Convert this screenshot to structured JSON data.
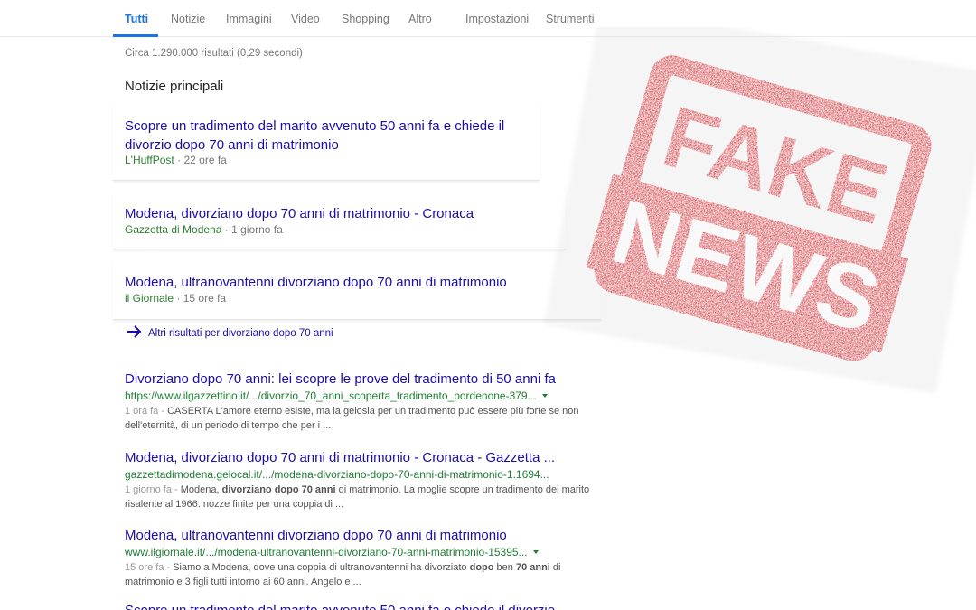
{
  "nav": {
    "tabs": [
      "Tutti",
      "Notizie",
      "Immagini",
      "Video",
      "Shopping",
      "Altro",
      "Impostazioni",
      "Strumenti"
    ],
    "active": "Tutti",
    "accent": "#1a73e8"
  },
  "stats": "Circa 1.290.000 risultati (0,29 secondi)",
  "top_stories": {
    "title": "Notizie principali",
    "cards": [
      {
        "title": "Scopre un tradimento del marito avvenuto 50 anni fa e chiede il divorzio dopo 70 anni di matrimonio",
        "source": "L'HuffPost",
        "time": "22 ore fa"
      },
      {
        "title": "Modena, divorziano dopo 70 anni di matrimonio - Cronaca",
        "source": "Gazzetta di Modena",
        "time": "1 giorno fa"
      },
      {
        "title": "Modena, ultranovantenni divorziano dopo 70 anni di matrimonio",
        "source": "il Giornale",
        "time": "15 ore fa"
      }
    ],
    "more_label": "Altri risultati per divorziano dopo 70 anni"
  },
  "results": [
    {
      "title": "Divorziano dopo 70 anni: lei scopre le prove del tradimento di 50 anni fa",
      "url": "https://www.ilgazzettino.it/.../divorzio_70_anni_scoperta_tradimento_pordenone-379...",
      "date": "1 ora fa",
      "snippet": "CASERTA L'amore eterno esiste, ma la gelosia per un tradimento può essere più forte se non dell'eternità, di un periodo di tempo che per i ..."
    },
    {
      "title": "Modena, divorziano dopo 70 anni di matrimonio - Cronaca - Gazzetta ...",
      "url": "gazzettadimodena.gelocal.it/.../modena-divorziano-dopo-70-anni-di-matrimonio-1.1694...",
      "date": "1 giorno fa",
      "snippet_parts": [
        "Modena, ",
        "divorziano dopo 70 anni",
        " di matrimonio. La moglie scopre un tradimento del marito risalente al 1966: nozze finite per una coppia di ..."
      ]
    },
    {
      "title": "Modena, ultranovantenni divorziano dopo 70 anni di matrimonio",
      "url": "www.ilgiornale.it/.../modena-ultranovantenni-divorziano-70-anni-matrimonio-15395...",
      "date": "15 ore fa",
      "snippet_parts": [
        "Siamo a Modena, dove una coppia di ultranovantenni ha divorziato ",
        "dopo",
        " ben ",
        "70 anni",
        " di matrimonio e 3 figli tutti intorno ai 60 anni. Angelo e ..."
      ]
    },
    {
      "title": "Scopre un tradimento del marito avvenuto 50 anni fa e chiede il divorzio"
    }
  ],
  "stamp": {
    "line1": "FAKE",
    "line2": "NEWS",
    "color": "#d7232a"
  },
  "colors": {
    "link": "#1a0dab",
    "url": "#1e7e34",
    "meta": "#777777"
  }
}
